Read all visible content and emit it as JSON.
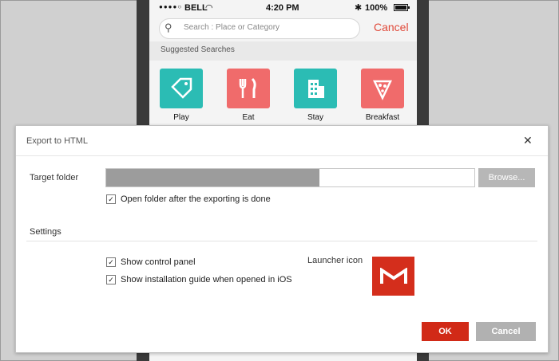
{
  "phone": {
    "status": {
      "carrier": "BELL",
      "time": "4:20 PM",
      "battery": "100%",
      "battery_level": 1.0
    },
    "search": {
      "placeholder": "Search : Place or Category",
      "cancel_label": "Cancel"
    },
    "suggested_title": "Suggested Searches",
    "tiles": [
      {
        "label": "Play",
        "icon": "tag-icon",
        "color": "#2bbcb4"
      },
      {
        "label": "Eat",
        "icon": "fork-knife-icon",
        "color": "#f06b6b"
      },
      {
        "label": "Stay",
        "icon": "building-icon",
        "color": "#2bbcb4"
      },
      {
        "label": "Breakfast",
        "icon": "pizza-icon",
        "color": "#f06b6b"
      }
    ]
  },
  "dialog": {
    "title": "Export to HTML",
    "target_folder_label": "Target folder",
    "browse_label": "Browse...",
    "open_folder_label": "Open folder after the exporting is done",
    "open_folder_checked": true,
    "settings_label": "Settings",
    "show_control_panel_label": "Show control panel",
    "show_control_panel_checked": true,
    "show_guide_label": "Show installation guide when opened in iOS",
    "show_guide_checked": true,
    "launcher_icon_label": "Launcher icon",
    "ok_label": "OK",
    "cancel_label": "Cancel",
    "accent": "#d12a17"
  }
}
